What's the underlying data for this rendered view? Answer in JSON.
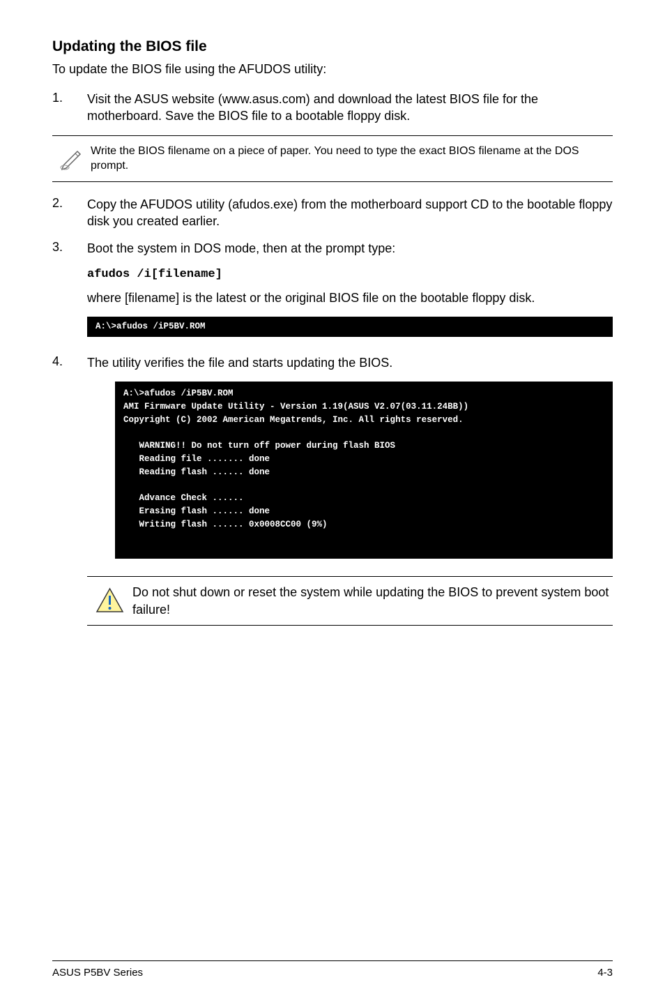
{
  "heading": "Updating the BIOS file",
  "intro": "To update the BIOS file using the AFUDOS utility:",
  "step1": {
    "num": "1.",
    "text": "Visit the ASUS website (www.asus.com) and download the latest BIOS file for the motherboard. Save the BIOS file to a bootable floppy disk."
  },
  "note1": "Write the BIOS filename on a piece of paper. You need to type the exact BIOS filename at the DOS prompt.",
  "step2": {
    "num": "2.",
    "text": "Copy the AFUDOS utility (afudos.exe) from the motherboard support CD to the bootable floppy disk you created earlier."
  },
  "step3": {
    "num": "3.",
    "text": "Boot the system in DOS mode, then at the prompt type:",
    "code": "afudos /i[filename]",
    "explain": "where [filename] is the latest or the original BIOS file on the bootable floppy disk."
  },
  "terminal1": "A:\\>afudos /iP5BV.ROM",
  "step4": {
    "num": "4.",
    "text": "The utility verifies the file and starts updating the BIOS."
  },
  "terminal2": "A:\\>afudos /iP5BV.ROM\nAMI Firmware Update Utility - Version 1.19(ASUS V2.07(03.11.24BB))\nCopyright (C) 2002 American Megatrends, Inc. All rights reserved.\n\n   WARNING!! Do not turn off power during flash BIOS\n   Reading file ....... done\n   Reading flash ...... done\n\n   Advance Check ......\n   Erasing flash ...... done\n   Writing flash ...... 0x0008CC00 (9%)",
  "warning": "Do not shut down or reset the system while updating the BIOS to prevent system boot failure!",
  "footer": {
    "left": "ASUS P5BV Series",
    "right": "4-3"
  }
}
